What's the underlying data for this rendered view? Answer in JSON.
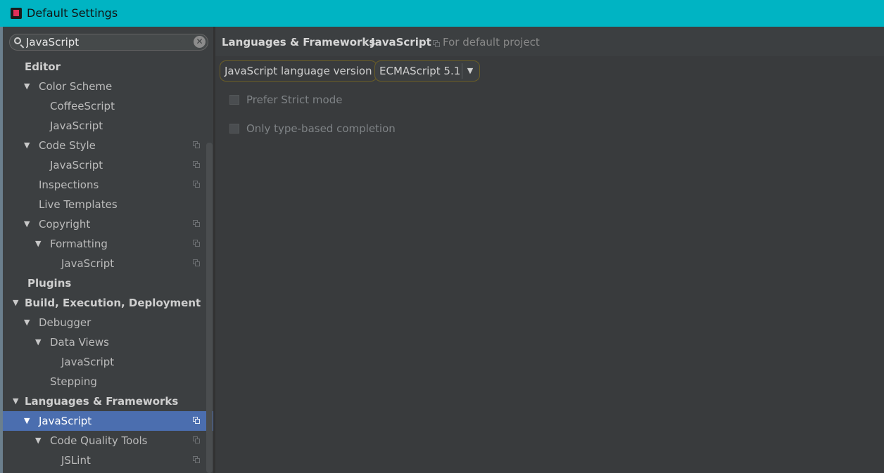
{
  "window": {
    "title": "Default Settings"
  },
  "search": {
    "value": "JavaScript",
    "clear_glyph": "✕"
  },
  "tree": [
    {
      "label": "Editor",
      "level": 0,
      "bold": true,
      "arrow": false,
      "copy": false,
      "selected": false
    },
    {
      "label": "Color Scheme",
      "level": 1,
      "bold": false,
      "arrow": true,
      "copy": false,
      "selected": false
    },
    {
      "label": "CoffeeScript",
      "level": 2,
      "bold": false,
      "arrow": false,
      "copy": false,
      "selected": false
    },
    {
      "label": "JavaScript",
      "level": 2,
      "bold": false,
      "arrow": false,
      "copy": false,
      "selected": false
    },
    {
      "label": "Code Style",
      "level": 1,
      "bold": false,
      "arrow": true,
      "copy": true,
      "selected": false
    },
    {
      "label": "JavaScript",
      "level": 2,
      "bold": false,
      "arrow": false,
      "copy": true,
      "selected": false
    },
    {
      "label": "Inspections",
      "level": 1,
      "bold": false,
      "arrow": false,
      "copy": true,
      "selected": false
    },
    {
      "label": "Live Templates",
      "level": 1,
      "bold": false,
      "arrow": false,
      "copy": false,
      "selected": false
    },
    {
      "label": "Copyright",
      "level": 1,
      "bold": false,
      "arrow": true,
      "copy": true,
      "selected": false
    },
    {
      "label": "Formatting",
      "level": 2,
      "bold": false,
      "arrow": true,
      "copy": true,
      "selected": false
    },
    {
      "label": "JavaScript",
      "level": 3,
      "bold": false,
      "arrow": false,
      "copy": true,
      "selected": false
    },
    {
      "label": "Plugins",
      "level": 0,
      "bold": true,
      "arrow": false,
      "copy": false,
      "selected": false
    },
    {
      "label": "Build, Execution, Deployment",
      "level": 0,
      "bold": true,
      "arrow": true,
      "copy": false,
      "selected": false
    },
    {
      "label": "Debugger",
      "level": 1,
      "bold": false,
      "arrow": true,
      "copy": false,
      "selected": false
    },
    {
      "label": "Data Views",
      "level": 2,
      "bold": false,
      "arrow": true,
      "copy": false,
      "selected": false
    },
    {
      "label": "JavaScript",
      "level": 3,
      "bold": false,
      "arrow": false,
      "copy": false,
      "selected": false
    },
    {
      "label": "Stepping",
      "level": 2,
      "bold": false,
      "arrow": false,
      "copy": false,
      "selected": false
    },
    {
      "label": "Languages & Frameworks",
      "level": 0,
      "bold": true,
      "arrow": true,
      "copy": false,
      "selected": false
    },
    {
      "label": "JavaScript",
      "level": 1,
      "bold": false,
      "arrow": true,
      "copy": true,
      "selected": true
    },
    {
      "label": "Code Quality Tools",
      "level": 2,
      "bold": false,
      "arrow": true,
      "copy": true,
      "selected": false
    },
    {
      "label": "JSLint",
      "level": 3,
      "bold": false,
      "arrow": false,
      "copy": true,
      "selected": false
    }
  ],
  "breadcrumb": {
    "part1": "Languages & Frameworks",
    "separator": "›",
    "part2": "JavaScript",
    "scope": "For default project"
  },
  "settings": {
    "language_version_label": "JavaScript language version",
    "language_version_value": "ECMAScript 5.1",
    "prefer_strict_label": "Prefer Strict mode",
    "prefer_strict_checked": false,
    "type_based_label": "Only type-based completion",
    "type_based_checked": false
  },
  "icons": {
    "app": "intellij-app-icon",
    "search": "search-icon",
    "clear": "clear-icon",
    "expand": "expand-arrow-icon",
    "project_scope": "project-scope-icon",
    "dropdown": "dropdown-caret-icon"
  }
}
